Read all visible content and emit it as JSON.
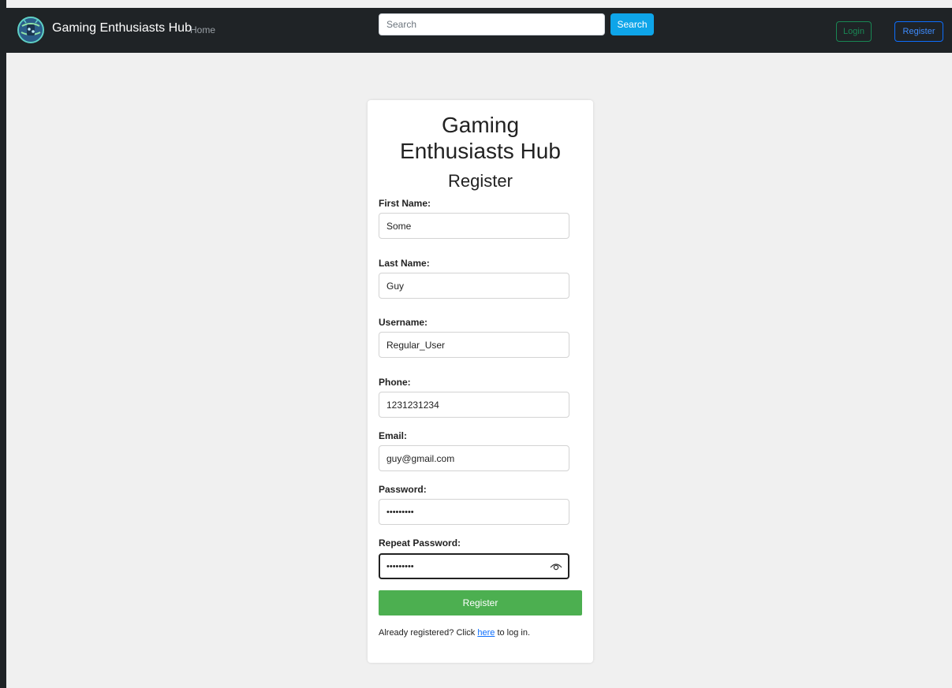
{
  "navbar": {
    "brand": "Gaming Enthusiasts Hub",
    "home_link": "Home",
    "search_placeholder": "Search",
    "search_button": "Search",
    "login_button": "Login",
    "register_button": "Register",
    "logo_icon": "gaming-globe-logo"
  },
  "form": {
    "title": "Gaming Enthusiasts Hub",
    "subtitle": "Register",
    "fields": [
      {
        "label": "First Name:",
        "value": "Some"
      },
      {
        "label": "Last Name:",
        "value": "Guy"
      },
      {
        "label": "Username:",
        "value": "Regular_User"
      },
      {
        "label": "Phone:",
        "value": "1231231234"
      },
      {
        "label": "Email:",
        "value": "guy@gmail.com"
      },
      {
        "label": "Password:",
        "value": "•••••••••"
      },
      {
        "label": "Repeat Password:",
        "value": "•••••••••"
      }
    ],
    "submit_label": "Register",
    "hint_prefix": "Already registered? Click",
    "hint_link": "here",
    "hint_suffix": "to log in."
  },
  "colors": {
    "navbar_bg": "#1f2326",
    "page_bg": "#f0f0f0",
    "search_button": "#0ea5e9",
    "login_outline": "#198754",
    "register_outline": "#0d6efd",
    "submit_bg": "#4caf50"
  }
}
